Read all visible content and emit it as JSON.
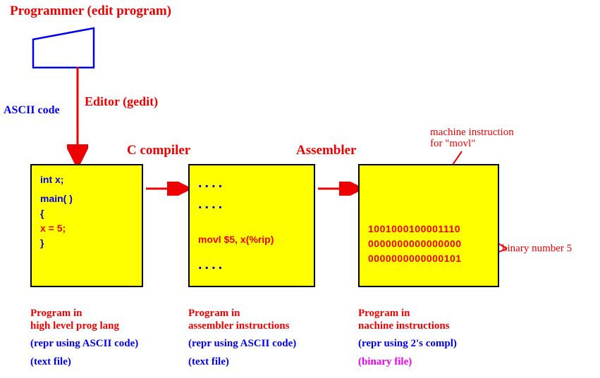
{
  "title": "Programmer (edit program)",
  "editorLabel": "Editor (gedit)",
  "asciiLabel": "ASCII code",
  "cCompiler": "C compiler",
  "assembler": "Assembler",
  "annotations": {
    "machineInstr1": "machine instruction",
    "machineInstr2": "for \"movl\"",
    "binNum5": "binary number 5"
  },
  "box1": {
    "line1": "int x;",
    "line2": "main( )",
    "line3": "{",
    "line4": "   x = 5;",
    "line5": "}"
  },
  "box2": {
    "movl": "movl   $5,  x(%rip)"
  },
  "box3": {
    "bin1": "1001000100001110",
    "bin2": "0000000000000000",
    "bin3": "0000000000000101"
  },
  "cap1": {
    "a": "Program in",
    "b": " high level prog lang",
    "c": "(repr using ASCII code)",
    "d": "(text file)"
  },
  "cap2": {
    "a": "Program in",
    "b": "assembler instructions",
    "c": "(repr using ASCII code)",
    "d": "(text file)"
  },
  "cap3": {
    "a": "Program in",
    "b": "nachine instructions",
    "c": "(repr using 2's compl)",
    "d": "(binary file)"
  }
}
